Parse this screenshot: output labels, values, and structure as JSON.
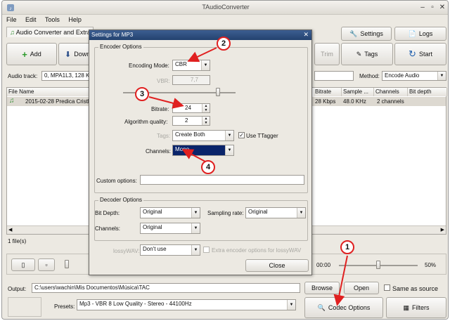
{
  "window": {
    "title": "TAudioConverter"
  },
  "menu": [
    "File",
    "Edit",
    "Tools",
    "Help"
  ],
  "main_tab": "Audio Converter and Extractor",
  "toolbar": {
    "add": "Add",
    "down": "Down",
    "trim": "Trim",
    "tags": "Tags",
    "start": "Start",
    "settings": "Settings",
    "logs": "Logs"
  },
  "audio_track": {
    "label": "Audio track:",
    "value": "0, MPA1L3, 128 Kb"
  },
  "method": {
    "label": "Method:",
    "value": "Encode Audio"
  },
  "file_list": {
    "columns": [
      "File Name",
      "Bitrate",
      "Sample ...",
      "Channels",
      "Bit depth"
    ],
    "rows": [
      {
        "name": "2015-02-28 Predica Cristh",
        "bitrate": "28 Kbps",
        "sample": "48.0 KHz",
        "channels": "2 channels",
        "bitdepth": ""
      }
    ]
  },
  "status": {
    "files": "1 file(s)",
    "time": "00:00",
    "volume": "50%"
  },
  "output": {
    "label": "Output:",
    "path": "C:\\users\\wachin\\Mis Documentos\\Música\\TAC",
    "browse": "Browse",
    "open": "Open",
    "same_as_source": "Same as source"
  },
  "presets": {
    "label": "Presets:",
    "value": "Mp3 - VBR 8 Low Quality - Stereo - 44100Hz"
  },
  "bottom_buttons": {
    "codec_options": "Codec Options",
    "filters": "Filters"
  },
  "dialog": {
    "title": "Settings for MP3",
    "encoder_options": "Encoder Options",
    "encoding_mode_label": "Encoding Mode:",
    "encoding_mode": "CBR",
    "vbr_label": "VBR:",
    "vbr": "7,7",
    "bitrate_label": "Bitrate:",
    "bitrate": "24",
    "algorithm_quality_label": "Algorithm quality:",
    "algorithm_quality": "2",
    "tags_label": "Tags:",
    "tags": "Create Both",
    "use_ttagger": "Use TTagger",
    "channels_label": "Channels:",
    "channels": "Mono",
    "custom_options_label": "Custom options:",
    "custom_options": "",
    "decoder_options": "Decoder Options",
    "bit_depth_label": "Bit Depth:",
    "bit_depth": "Original",
    "sampling_rate_label": "Sampling rate:",
    "sampling_rate": "Original",
    "dec_channels_label": "Channels:",
    "dec_channels": "Original",
    "lossywav_label": "lossyWAV:",
    "lossywav": "Don't use",
    "extra_encoder": "Extra encoder options for lossyWAV",
    "close": "Close"
  },
  "annotations": [
    "1",
    "2",
    "3",
    "4"
  ],
  "colors": {
    "arrow": "#e02020",
    "selection": "#0a246a",
    "title_bar": "#2d4f80"
  }
}
